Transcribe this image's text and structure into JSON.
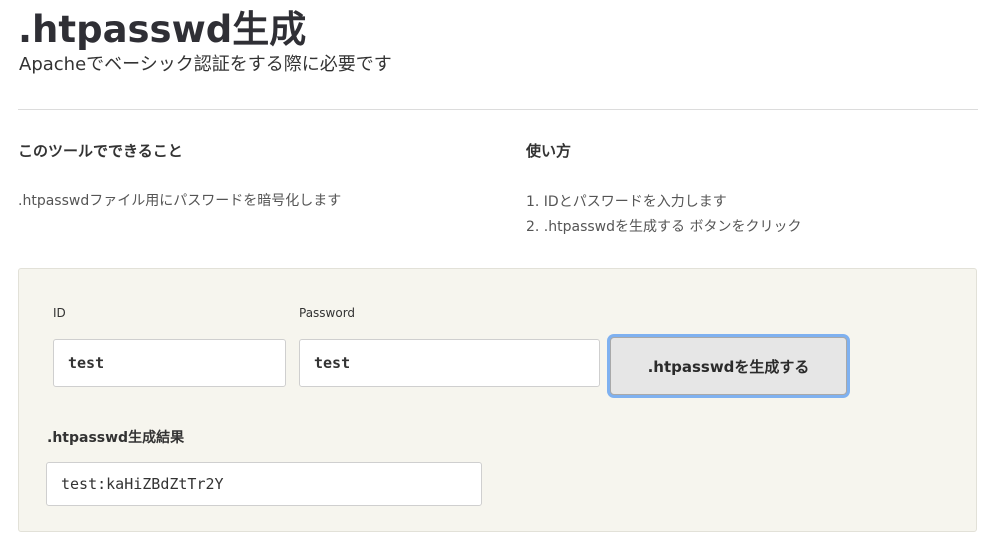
{
  "page": {
    "title": ".htpasswd生成",
    "subtitle": "Apacheでベーシック認証をする際に必要です"
  },
  "about": {
    "heading": "このツールでできること",
    "description": ".htpasswdファイル用にパスワードを暗号化します"
  },
  "usage": {
    "heading": "使い方",
    "steps": [
      "1. IDとパスワードを入力します",
      "2. .htpasswdを生成する ボタンをクリック"
    ]
  },
  "form": {
    "id_label": "ID",
    "id_value": "test",
    "password_label": "Password",
    "password_value": "test",
    "generate_button_label": ".htpasswdを生成する",
    "result_label": ".htpasswd生成結果",
    "result_value": "test:kaHiZBdZtTr2Y"
  },
  "colors": {
    "panel_background": "#f6f5ee",
    "button_focus_ring": "#7fb1f0",
    "title_text": "#2f2f35"
  }
}
